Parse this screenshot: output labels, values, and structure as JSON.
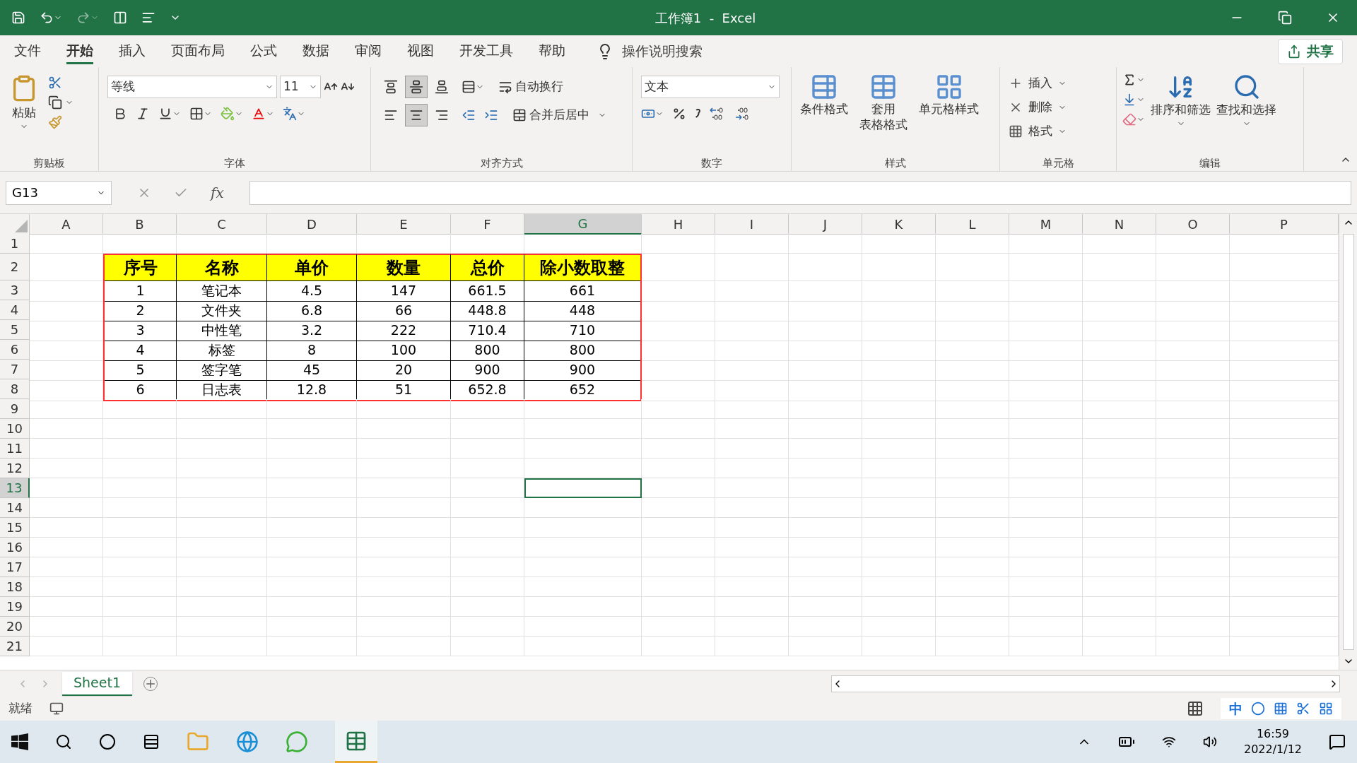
{
  "title_bar": {
    "title": "工作簿1  -  Excel"
  },
  "menu_tabs": [
    {
      "label": "文件",
      "selected": false
    },
    {
      "label": "开始",
      "selected": true
    },
    {
      "label": "插入",
      "selected": false
    },
    {
      "label": "页面布局",
      "selected": false
    },
    {
      "label": "公式",
      "selected": false
    },
    {
      "label": "数据",
      "selected": false
    },
    {
      "label": "审阅",
      "selected": false
    },
    {
      "label": "视图",
      "selected": false
    },
    {
      "label": "开发工具",
      "selected": false
    },
    {
      "label": "帮助",
      "selected": false
    }
  ],
  "search": {
    "placeholder": "操作说明搜索"
  },
  "share_button": "共享",
  "ribbon": {
    "clipboard": {
      "label": "剪贴板",
      "paste": "粘贴"
    },
    "font": {
      "label": "字体",
      "font_name": "等线",
      "font_size": "11"
    },
    "alignment": {
      "label": "对齐方式",
      "vertical": [
        {
          "selected": false
        },
        {
          "selected": true
        },
        {
          "selected": false
        }
      ],
      "horizontal": [
        {
          "selected": false
        },
        {
          "selected": true
        },
        {
          "selected": false
        }
      ],
      "wrap": "自动换行",
      "merge": "合并后居中"
    },
    "number": {
      "label": "数字",
      "format": "文本"
    },
    "styles": {
      "label": "样式",
      "buttons": [
        {
          "line1": "条件格式"
        },
        {
          "line1": "套用",
          "line2": "表格格式"
        },
        {
          "line1": "单元格样式"
        }
      ]
    },
    "cells": {
      "label": "单元格",
      "buttons": [
        "插入",
        "删除",
        "格式"
      ]
    },
    "editing": {
      "label": "编辑",
      "buttons": [
        "排序和筛选",
        "查找和选择"
      ]
    }
  },
  "formula_bar": {
    "name_box": "G13",
    "fx": "fx"
  },
  "sheet": {
    "columns": [
      {
        "label": "A",
        "selected": false
      },
      {
        "label": "B",
        "selected": false
      },
      {
        "label": "C",
        "selected": false
      },
      {
        "label": "D",
        "selected": false
      },
      {
        "label": "E",
        "selected": false
      },
      {
        "label": "F",
        "selected": false
      },
      {
        "label": "G",
        "selected": true
      },
      {
        "label": "H",
        "selected": false
      },
      {
        "label": "I",
        "selected": false
      },
      {
        "label": "J",
        "selected": false
      },
      {
        "label": "K",
        "selected": false
      },
      {
        "label": "L",
        "selected": false
      },
      {
        "label": "M",
        "selected": false
      },
      {
        "label": "N",
        "selected": false
      },
      {
        "label": "O",
        "selected": false
      },
      {
        "label": "P",
        "selected": false
      }
    ],
    "rows": [
      {
        "header": "1",
        "selected": false
      },
      {
        "header": "2",
        "selected": false,
        "kind": "table-header",
        "cells": {
          "B": "序号",
          "C": "名称",
          "D": "单价",
          "E": "数量",
          "F": "总价",
          "G": "除小数取整"
        }
      },
      {
        "header": "3",
        "selected": false,
        "kind": "table-row",
        "cells": {
          "B": "1",
          "C": "笔记本",
          "D": "4.5",
          "E": "147",
          "F": "661.5",
          "G": "661"
        }
      },
      {
        "header": "4",
        "selected": false,
        "kind": "table-row",
        "cells": {
          "B": "2",
          "C": "文件夹",
          "D": "6.8",
          "E": "66",
          "F": "448.8",
          "G": "448"
        }
      },
      {
        "header": "5",
        "selected": false,
        "kind": "table-row",
        "cells": {
          "B": "3",
          "C": "中性笔",
          "D": "3.2",
          "E": "222",
          "F": "710.4",
          "G": "710"
        }
      },
      {
        "header": "6",
        "selected": false,
        "kind": "table-row",
        "cells": {
          "B": "4",
          "C": "标签",
          "D": "8",
          "E": "100",
          "F": "800",
          "G": "800"
        }
      },
      {
        "header": "7",
        "selected": false,
        "kind": "table-row",
        "cells": {
          "B": "5",
          "C": "签字笔",
          "D": "45",
          "E": "20",
          "F": "900",
          "G": "900"
        }
      },
      {
        "header": "8",
        "selected": false,
        "kind": "table-row",
        "cells": {
          "B": "6",
          "C": "日志表",
          "D": "12.8",
          "E": "51",
          "F": "652.8",
          "G": "652"
        }
      },
      {
        "header": "9",
        "selected": false
      },
      {
        "header": "10",
        "selected": false
      },
      {
        "header": "11",
        "selected": false
      },
      {
        "header": "12",
        "selected": false
      },
      {
        "header": "13",
        "selected": true
      },
      {
        "header": "14",
        "selected": false
      },
      {
        "header": "15",
        "selected": false
      },
      {
        "header": "16",
        "selected": false
      },
      {
        "header": "17",
        "selected": false
      },
      {
        "header": "18",
        "selected": false
      },
      {
        "header": "19",
        "selected": false
      },
      {
        "header": "20",
        "selected": false
      },
      {
        "header": "21",
        "selected": false
      }
    ]
  },
  "sheet_tabs": [
    {
      "label": "Sheet1",
      "selected": true
    }
  ],
  "status_bar": {
    "status": "就绪"
  },
  "taskbar": {
    "ime": "中",
    "time": "16:59",
    "date": "2022/1/12"
  }
}
